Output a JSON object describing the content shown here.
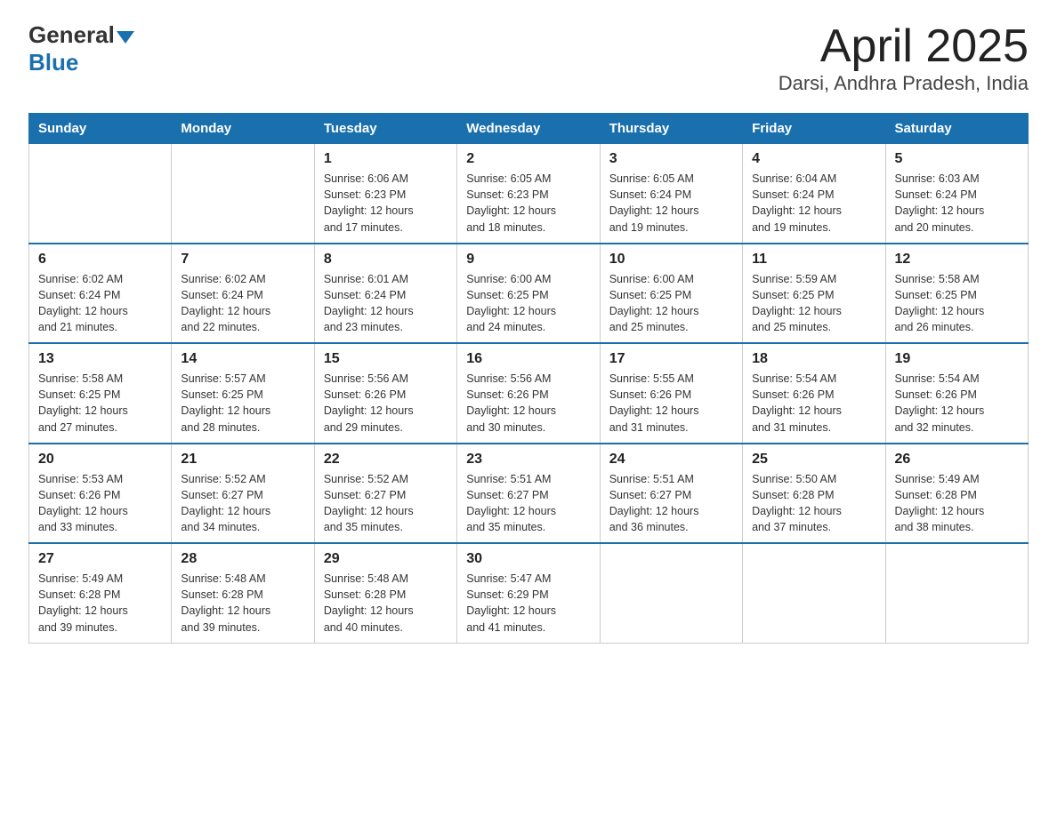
{
  "logo": {
    "general": "General",
    "blue": "Blue"
  },
  "title": "April 2025",
  "subtitle": "Darsi, Andhra Pradesh, India",
  "days": [
    "Sunday",
    "Monday",
    "Tuesday",
    "Wednesday",
    "Thursday",
    "Friday",
    "Saturday"
  ],
  "weeks": [
    [
      {
        "day": "",
        "info": ""
      },
      {
        "day": "",
        "info": ""
      },
      {
        "day": "1",
        "info": "Sunrise: 6:06 AM\nSunset: 6:23 PM\nDaylight: 12 hours\nand 17 minutes."
      },
      {
        "day": "2",
        "info": "Sunrise: 6:05 AM\nSunset: 6:23 PM\nDaylight: 12 hours\nand 18 minutes."
      },
      {
        "day": "3",
        "info": "Sunrise: 6:05 AM\nSunset: 6:24 PM\nDaylight: 12 hours\nand 19 minutes."
      },
      {
        "day": "4",
        "info": "Sunrise: 6:04 AM\nSunset: 6:24 PM\nDaylight: 12 hours\nand 19 minutes."
      },
      {
        "day": "5",
        "info": "Sunrise: 6:03 AM\nSunset: 6:24 PM\nDaylight: 12 hours\nand 20 minutes."
      }
    ],
    [
      {
        "day": "6",
        "info": "Sunrise: 6:02 AM\nSunset: 6:24 PM\nDaylight: 12 hours\nand 21 minutes."
      },
      {
        "day": "7",
        "info": "Sunrise: 6:02 AM\nSunset: 6:24 PM\nDaylight: 12 hours\nand 22 minutes."
      },
      {
        "day": "8",
        "info": "Sunrise: 6:01 AM\nSunset: 6:24 PM\nDaylight: 12 hours\nand 23 minutes."
      },
      {
        "day": "9",
        "info": "Sunrise: 6:00 AM\nSunset: 6:25 PM\nDaylight: 12 hours\nand 24 minutes."
      },
      {
        "day": "10",
        "info": "Sunrise: 6:00 AM\nSunset: 6:25 PM\nDaylight: 12 hours\nand 25 minutes."
      },
      {
        "day": "11",
        "info": "Sunrise: 5:59 AM\nSunset: 6:25 PM\nDaylight: 12 hours\nand 25 minutes."
      },
      {
        "day": "12",
        "info": "Sunrise: 5:58 AM\nSunset: 6:25 PM\nDaylight: 12 hours\nand 26 minutes."
      }
    ],
    [
      {
        "day": "13",
        "info": "Sunrise: 5:58 AM\nSunset: 6:25 PM\nDaylight: 12 hours\nand 27 minutes."
      },
      {
        "day": "14",
        "info": "Sunrise: 5:57 AM\nSunset: 6:25 PM\nDaylight: 12 hours\nand 28 minutes."
      },
      {
        "day": "15",
        "info": "Sunrise: 5:56 AM\nSunset: 6:26 PM\nDaylight: 12 hours\nand 29 minutes."
      },
      {
        "day": "16",
        "info": "Sunrise: 5:56 AM\nSunset: 6:26 PM\nDaylight: 12 hours\nand 30 minutes."
      },
      {
        "day": "17",
        "info": "Sunrise: 5:55 AM\nSunset: 6:26 PM\nDaylight: 12 hours\nand 31 minutes."
      },
      {
        "day": "18",
        "info": "Sunrise: 5:54 AM\nSunset: 6:26 PM\nDaylight: 12 hours\nand 31 minutes."
      },
      {
        "day": "19",
        "info": "Sunrise: 5:54 AM\nSunset: 6:26 PM\nDaylight: 12 hours\nand 32 minutes."
      }
    ],
    [
      {
        "day": "20",
        "info": "Sunrise: 5:53 AM\nSunset: 6:26 PM\nDaylight: 12 hours\nand 33 minutes."
      },
      {
        "day": "21",
        "info": "Sunrise: 5:52 AM\nSunset: 6:27 PM\nDaylight: 12 hours\nand 34 minutes."
      },
      {
        "day": "22",
        "info": "Sunrise: 5:52 AM\nSunset: 6:27 PM\nDaylight: 12 hours\nand 35 minutes."
      },
      {
        "day": "23",
        "info": "Sunrise: 5:51 AM\nSunset: 6:27 PM\nDaylight: 12 hours\nand 35 minutes."
      },
      {
        "day": "24",
        "info": "Sunrise: 5:51 AM\nSunset: 6:27 PM\nDaylight: 12 hours\nand 36 minutes."
      },
      {
        "day": "25",
        "info": "Sunrise: 5:50 AM\nSunset: 6:28 PM\nDaylight: 12 hours\nand 37 minutes."
      },
      {
        "day": "26",
        "info": "Sunrise: 5:49 AM\nSunset: 6:28 PM\nDaylight: 12 hours\nand 38 minutes."
      }
    ],
    [
      {
        "day": "27",
        "info": "Sunrise: 5:49 AM\nSunset: 6:28 PM\nDaylight: 12 hours\nand 39 minutes."
      },
      {
        "day": "28",
        "info": "Sunrise: 5:48 AM\nSunset: 6:28 PM\nDaylight: 12 hours\nand 39 minutes."
      },
      {
        "day": "29",
        "info": "Sunrise: 5:48 AM\nSunset: 6:28 PM\nDaylight: 12 hours\nand 40 minutes."
      },
      {
        "day": "30",
        "info": "Sunrise: 5:47 AM\nSunset: 6:29 PM\nDaylight: 12 hours\nand 41 minutes."
      },
      {
        "day": "",
        "info": ""
      },
      {
        "day": "",
        "info": ""
      },
      {
        "day": "",
        "info": ""
      }
    ]
  ]
}
